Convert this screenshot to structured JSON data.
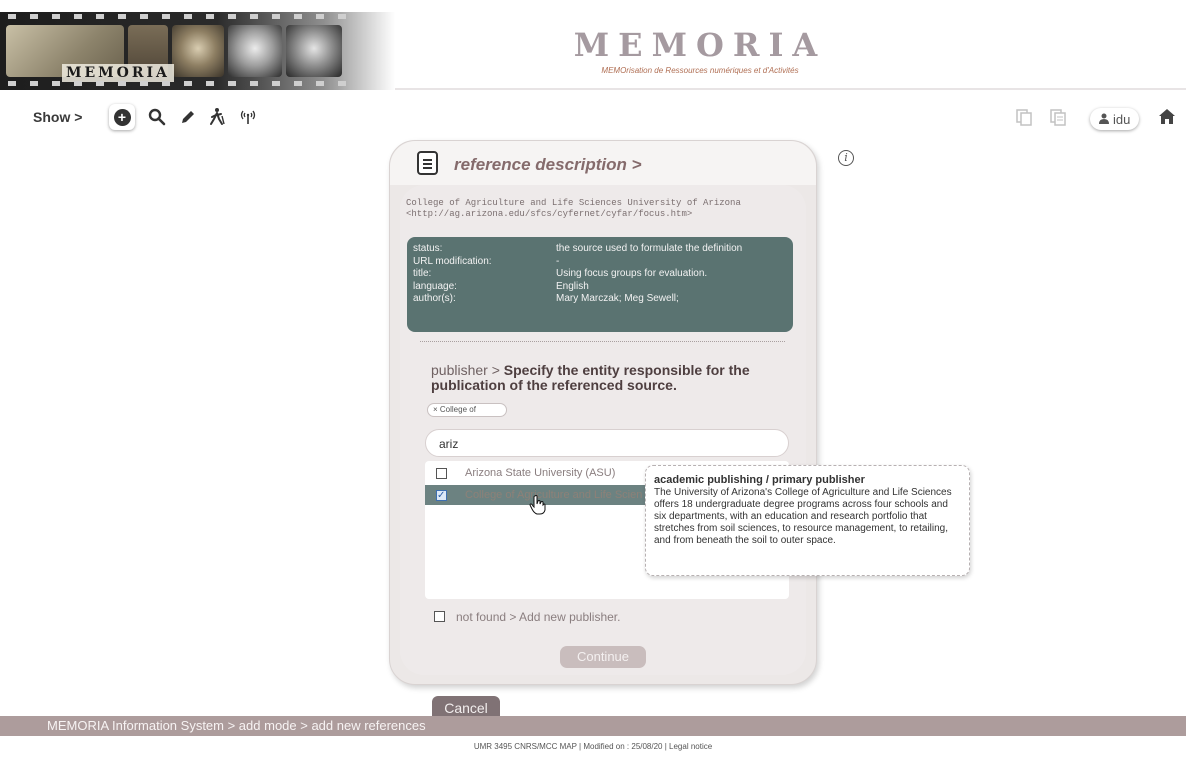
{
  "banner": {
    "logo_text": "MEMORIA",
    "title": "MEMORIA",
    "subtitle": "MEMOrisation de Ressources numériques et d'Activités"
  },
  "toolbar": {
    "show_label": "Show >",
    "icons": [
      "add-icon",
      "search-icon",
      "pencil-icon",
      "walking-person-icon",
      "signal-icon"
    ],
    "right_icons": [
      "document-copy-icon",
      "document-paste-icon"
    ],
    "user_label": "idu",
    "home_icon": "home-icon"
  },
  "panel": {
    "title": "reference description >",
    "citation_line1": "College of Agriculture and Life Sciences University of Arizona",
    "citation_line2": "<http://ag.arizona.edu/sfcs/cyfernet/cyfar/focus.htm>",
    "meta": [
      {
        "key": "status:",
        "value": "the source used to formulate the definition"
      },
      {
        "key": "URL modification:",
        "value": "-"
      },
      {
        "key": "title:",
        "value": "Using focus groups for evaluation."
      },
      {
        "key": "language:",
        "value": "English"
      },
      {
        "key": "author(s):",
        "value": "Mary Marczak; Meg Sewell;"
      }
    ],
    "publisher_label": "publisher > ",
    "publisher_desc": "Specify the entity responsible for the publication of the referenced source.",
    "chip_text": "× College of",
    "search_value": "ariz",
    "results": [
      {
        "label": "Arizona State University (ASU)",
        "checked": false
      },
      {
        "label": "College of Agriculture and Life Scien",
        "checked": true
      }
    ],
    "not_found_label": "not found > Add new publisher.",
    "continue_label": "Continue"
  },
  "tooltip": {
    "title": "academic publishing / primary publisher",
    "body": "The University of Arizona's College of Agriculture and Life Sciences offers 18 undergraduate degree programs across four schools and six departments, with an education and research portfolio that stretches from soil sciences, to resource management, to retailing, and from beneath the soil to outer space."
  },
  "cancel_label": "Cancel",
  "status_bar": "MEMORIA  Information System  >  add mode > add new references",
  "footer": "UMR 3495 CNRS/MCC MAP   |   Modified on : 25/08/20   |   Legal notice",
  "colors": {
    "meta_box": "#5a7371",
    "status_bar": "#ad9c9c",
    "title_accent": "#856b6c",
    "selected_row": "#6c8281"
  }
}
